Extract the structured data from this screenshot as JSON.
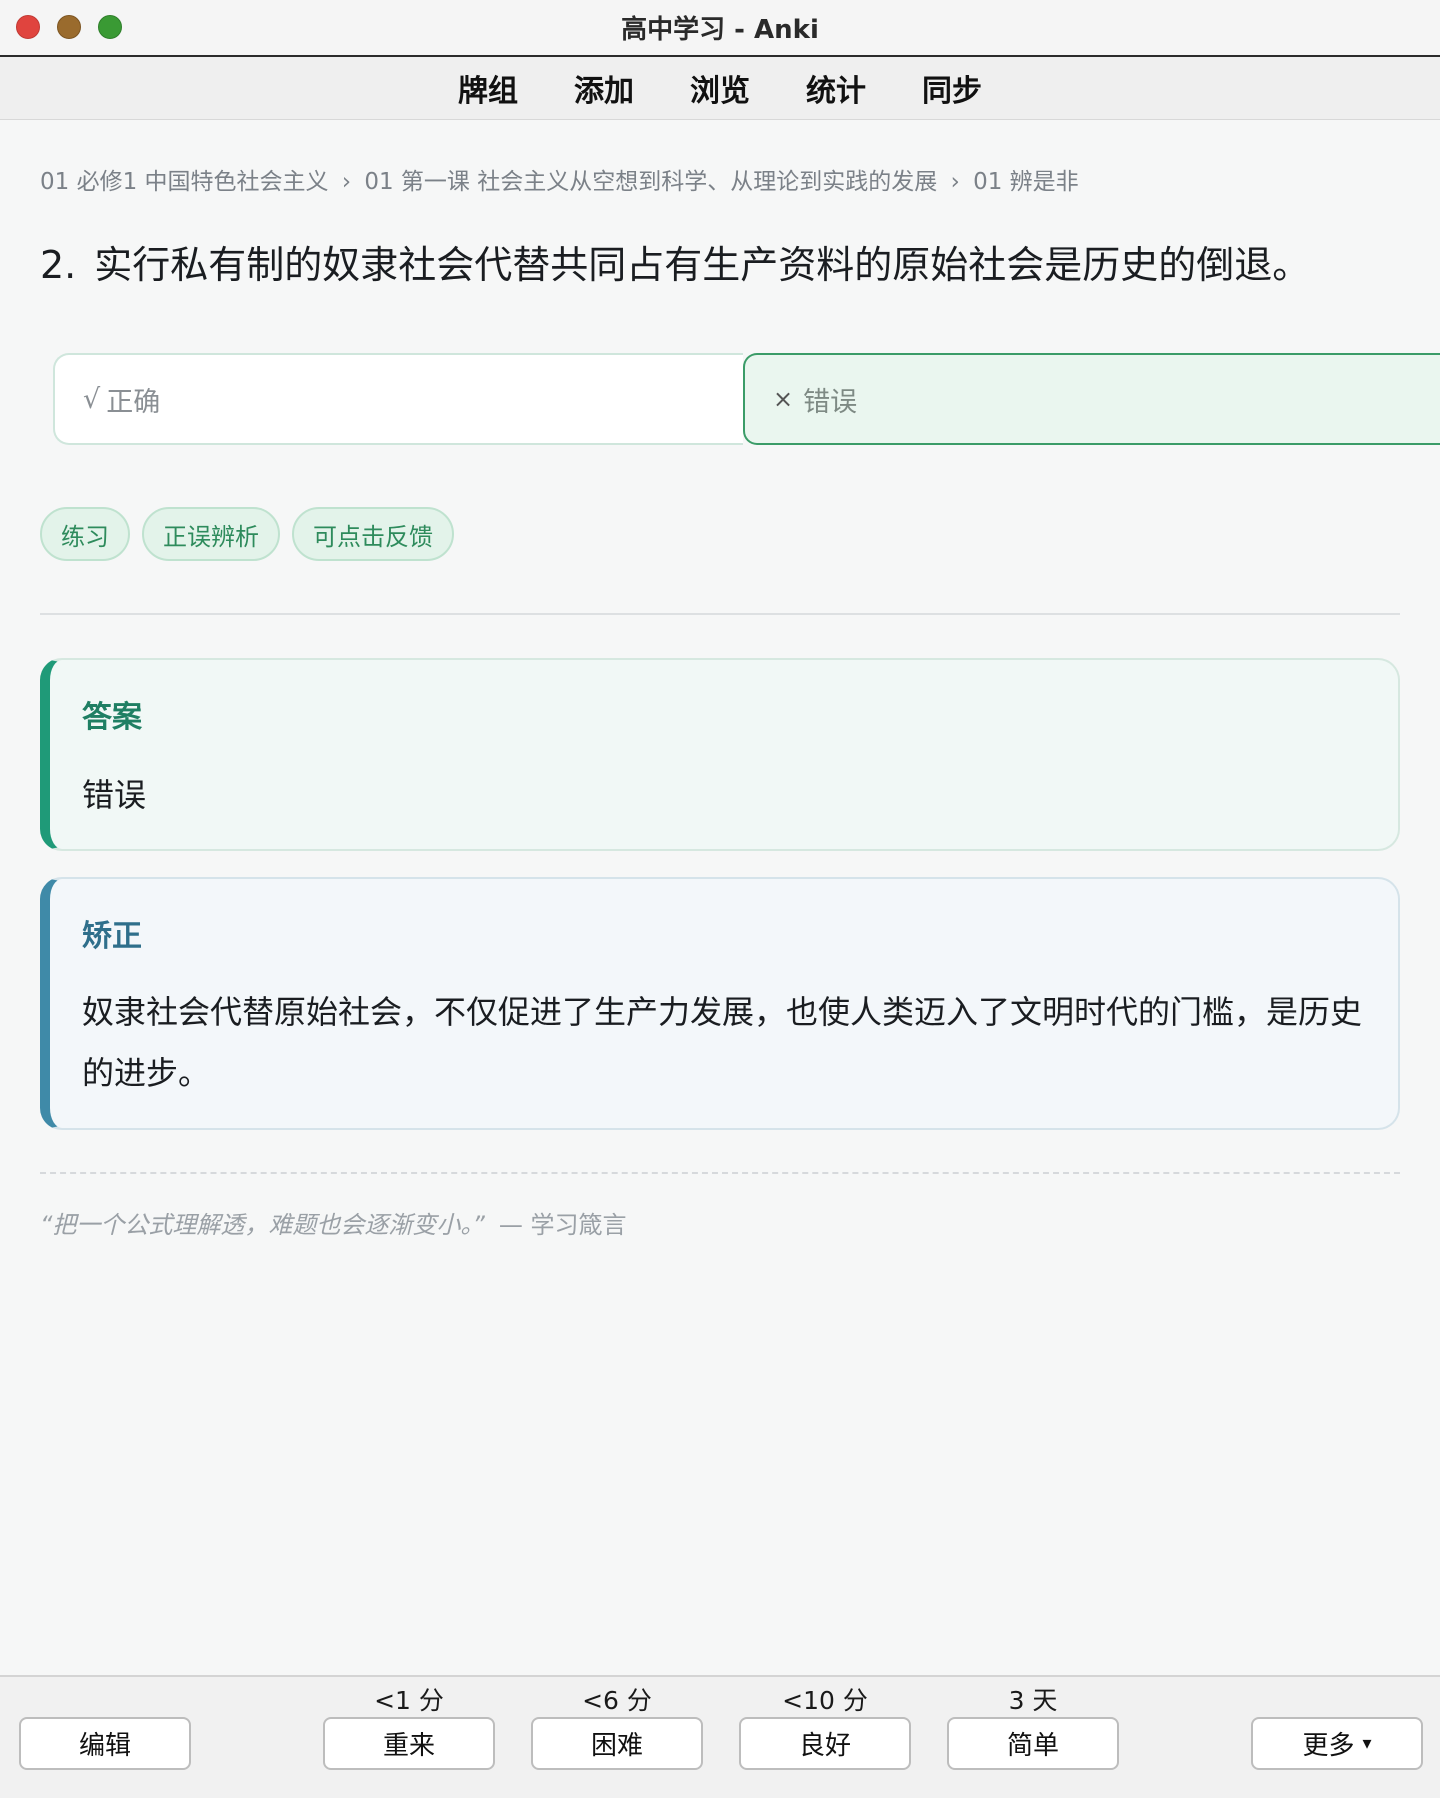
{
  "window": {
    "title": "高中学习 - Anki"
  },
  "toolbar": {
    "items": [
      "牌组",
      "添加",
      "浏览",
      "统计",
      "同步"
    ]
  },
  "breadcrumb": {
    "items": [
      "01 必修1 中国特色社会主义",
      "01 第一课 社会主义从空想到科学、从理论到实践的发展",
      "01 辨是非"
    ],
    "separator": "›"
  },
  "question": {
    "number": "2.",
    "text": "实行私有制的奴隶社会代替共同占有生产资料的原始社会是历史的倒退。"
  },
  "options": [
    {
      "mark": "√",
      "label": "正确",
      "selected": false
    },
    {
      "mark": "×",
      "label": "错误",
      "selected": true
    }
  ],
  "tags": [
    "练习",
    "正误辨析",
    "可点击反馈"
  ],
  "answer": {
    "label": "答案",
    "value": "错误"
  },
  "correction": {
    "label": "矫正",
    "text": "奴隶社会代替原始社会，不仅促进了生产力发展，也使人类迈入了文明时代的门槛，是历史的进步。"
  },
  "quote": {
    "text": "“把一个公式理解透，难题也会逐渐变小。”",
    "source": "— 学习箴言"
  },
  "bottom": {
    "edit": "编辑",
    "buttons": [
      {
        "interval": "<1 分",
        "label": "重来"
      },
      {
        "interval": "<6 分",
        "label": "困难"
      },
      {
        "interval": "<10 分",
        "label": "良好"
      },
      {
        "interval": "3 天",
        "label": "简单"
      }
    ],
    "more": "更多",
    "more_icon": "▾"
  },
  "colors": {
    "answer_accent": "#1f9a78",
    "correction_accent": "#3f8aa8",
    "selected_option_border": "#3b9c68",
    "tag_text": "#2e8b5c"
  }
}
